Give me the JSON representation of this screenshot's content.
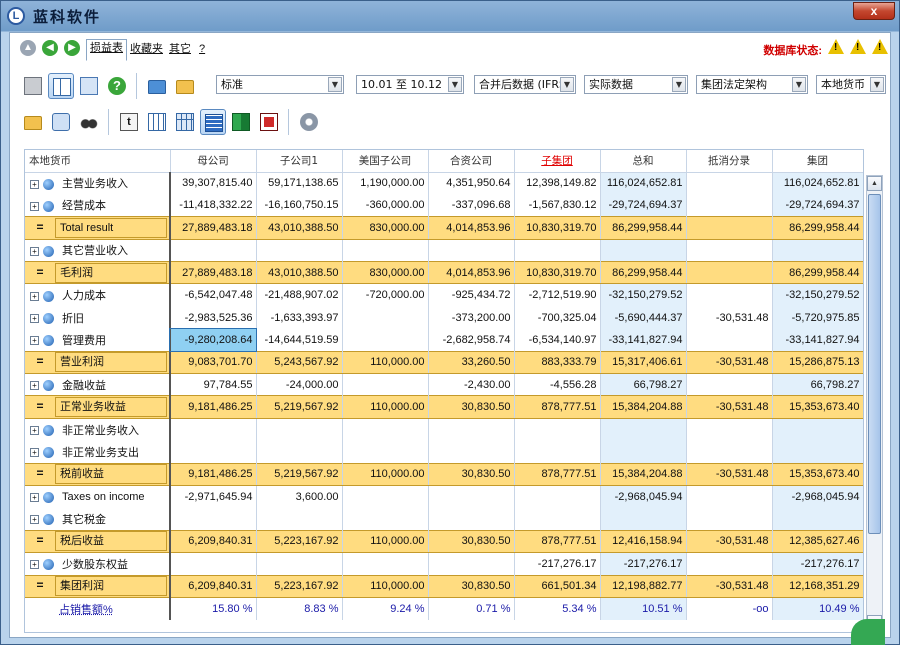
{
  "app": {
    "title": "蓝科软件",
    "close": "x"
  },
  "nav": {
    "tabs": [
      {
        "label": "损益表",
        "active": true
      },
      {
        "label": "收藏夹",
        "active": false
      },
      {
        "label": "其它",
        "active": false
      },
      {
        "label": "?",
        "active": false
      }
    ],
    "db_status": "数据库状态:"
  },
  "filters": {
    "layout": "标准",
    "period": "10.01 至 10.12",
    "dataset": "合并后数据 (IFRS)",
    "version": "实际数据",
    "structure": "集团法定架构",
    "currency": "本地货币"
  },
  "grid": {
    "corner_label": "本地货币",
    "columns": [
      "母公司",
      "子公司1",
      "美国子公司",
      "合资公司",
      "子集团",
      "总和",
      "抵消分录",
      "集团"
    ],
    "rows": [
      {
        "type": "line",
        "label": "主营业务收入",
        "values": [
          "39,307,815.40",
          "59,171,138.65",
          "1,190,000.00",
          "4,351,950.64",
          "12,398,149.82",
          "116,024,652.81",
          "",
          "116,024,652.81"
        ]
      },
      {
        "type": "line",
        "label": "经营成本",
        "values": [
          "-11,418,332.22",
          "-16,160,750.15",
          "-360,000.00",
          "-337,096.68",
          "-1,567,830.12",
          "-29,724,694.37",
          "",
          "-29,724,694.37"
        ]
      },
      {
        "type": "total",
        "label": "Total result",
        "values": [
          "27,889,483.18",
          "43,010,388.50",
          "830,000.00",
          "4,014,853.96",
          "10,830,319.70",
          "86,299,958.44",
          "",
          "86,299,958.44"
        ]
      },
      {
        "type": "line",
        "label": "其它营业收入",
        "values": [
          "",
          "",
          "",
          "",
          "",
          "",
          "",
          ""
        ]
      },
      {
        "type": "total",
        "label": "毛利润",
        "values": [
          "27,889,483.18",
          "43,010,388.50",
          "830,000.00",
          "4,014,853.96",
          "10,830,319.70",
          "86,299,958.44",
          "",
          "86,299,958.44"
        ]
      },
      {
        "type": "line",
        "label": "人力成本",
        "values": [
          "-6,542,047.48",
          "-21,488,907.02",
          "-720,000.00",
          "-925,434.72",
          "-2,712,519.90",
          "-32,150,279.52",
          "",
          "-32,150,279.52"
        ]
      },
      {
        "type": "line",
        "label": "折旧",
        "values": [
          "-2,983,525.36",
          "-1,633,393.97",
          "",
          "-373,200.00",
          "-700,325.04",
          "-5,690,444.37",
          "-30,531.48",
          "-5,720,975.85"
        ]
      },
      {
        "type": "line",
        "label": "管理费用",
        "values": [
          "-9,280,208.64",
          "-14,644,519.59",
          "",
          "-2,682,958.74",
          "-6,534,140.97",
          "-33,141,827.94",
          "",
          "-33,141,827.94"
        ]
      },
      {
        "type": "total",
        "label": "营业利润",
        "values": [
          "9,083,701.70",
          "5,243,567.92",
          "110,000.00",
          "33,260.50",
          "883,333.79",
          "15,317,406.61",
          "-30,531.48",
          "15,286,875.13"
        ]
      },
      {
        "type": "line",
        "label": "金融收益",
        "values": [
          "97,784.55",
          "-24,000.00",
          "",
          "-2,430.00",
          "-4,556.28",
          "66,798.27",
          "",
          "66,798.27"
        ]
      },
      {
        "type": "total",
        "label": "正常业务收益",
        "values": [
          "9,181,486.25",
          "5,219,567.92",
          "110,000.00",
          "30,830.50",
          "878,777.51",
          "15,384,204.88",
          "-30,531.48",
          "15,353,673.40"
        ]
      },
      {
        "type": "line",
        "label": "非正常业务收入",
        "values": [
          "",
          "",
          "",
          "",
          "",
          "",
          "",
          ""
        ]
      },
      {
        "type": "line",
        "label": "非正常业务支出",
        "values": [
          "",
          "",
          "",
          "",
          "",
          "",
          "",
          ""
        ]
      },
      {
        "type": "total",
        "label": "税前收益",
        "values": [
          "9,181,486.25",
          "5,219,567.92",
          "110,000.00",
          "30,830.50",
          "878,777.51",
          "15,384,204.88",
          "-30,531.48",
          "15,353,673.40"
        ]
      },
      {
        "type": "line",
        "label": "Taxes on income",
        "values": [
          "-2,971,645.94",
          "3,600.00",
          "",
          "",
          "",
          "-2,968,045.94",
          "",
          "-2,968,045.94"
        ]
      },
      {
        "type": "line",
        "label": "其它税金",
        "values": [
          "",
          "",
          "",
          "",
          "",
          "",
          "",
          ""
        ]
      },
      {
        "type": "total",
        "label": "税后收益",
        "values": [
          "6,209,840.31",
          "5,223,167.92",
          "110,000.00",
          "30,830.50",
          "878,777.51",
          "12,416,158.94",
          "-30,531.48",
          "12,385,627.46"
        ]
      },
      {
        "type": "line",
        "label": "少数股东权益",
        "values": [
          "",
          "",
          "",
          "",
          "-217,276.17",
          "-217,276.17",
          "",
          "-217,276.17"
        ]
      },
      {
        "type": "total",
        "label": "集团利润",
        "values": [
          "6,209,840.31",
          "5,223,167.92",
          "110,000.00",
          "30,830.50",
          "661,501.34",
          "12,198,882.77",
          "-30,531.48",
          "12,168,351.29"
        ]
      },
      {
        "type": "pct",
        "label": "占销售额%",
        "values": [
          "15.80 %",
          "8.83 %",
          "9.24 %",
          "0.71 %",
          "5.34 %",
          "10.51 %",
          "-oo",
          "10.49 %"
        ]
      }
    ]
  }
}
